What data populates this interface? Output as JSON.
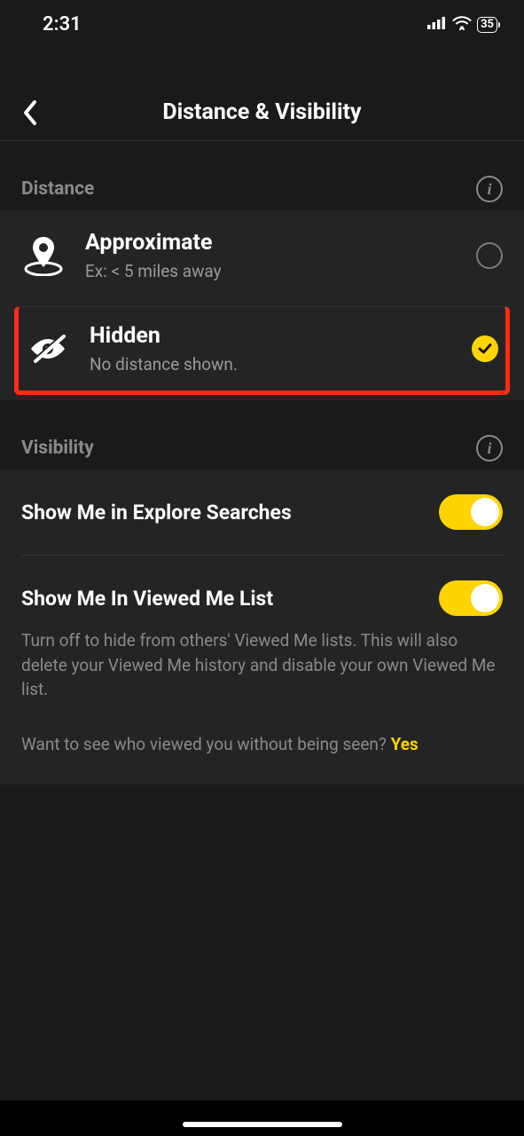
{
  "status": {
    "time": "2:31",
    "battery": "35"
  },
  "header": {
    "title": "Distance & Visibility"
  },
  "sections": {
    "distance": {
      "title": "Distance",
      "options": {
        "approximate": {
          "title": "Approximate",
          "subtitle": "Ex: < 5 miles away"
        },
        "hidden": {
          "title": "Hidden",
          "subtitle": "No distance shown."
        }
      }
    },
    "visibility": {
      "title": "Visibility",
      "explore": {
        "title": "Show Me in Explore Searches"
      },
      "viewed": {
        "title": "Show Me In Viewed Me List",
        "desc": "Turn off to hide from others' Viewed Me lists. This will also delete your Viewed Me history and disable your own Viewed Me list.",
        "prompt": "Want to see who viewed you without being seen? ",
        "yes": "Yes"
      }
    }
  }
}
